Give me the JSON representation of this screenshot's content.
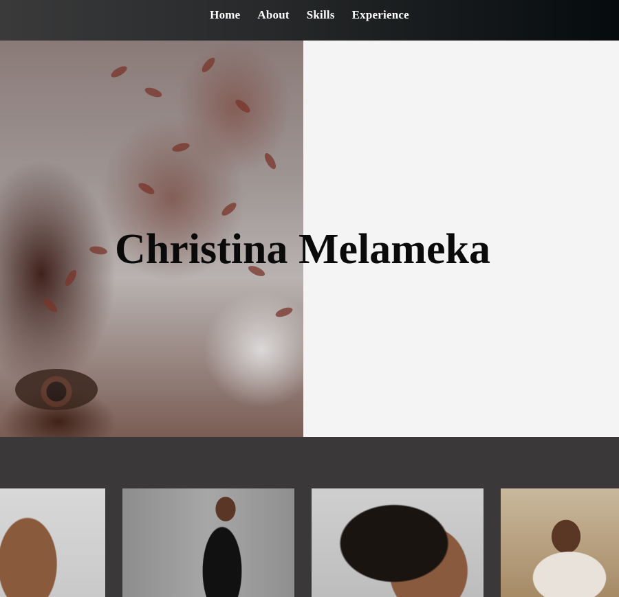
{
  "nav": {
    "items": [
      {
        "label": "Home"
      },
      {
        "label": "About"
      },
      {
        "label": "Skills"
      },
      {
        "label": "Experience"
      }
    ]
  },
  "hero": {
    "title": "Christina Melameka",
    "photo_description_icon": "portrait-photo"
  },
  "gallery": {
    "thumbs": [
      {
        "icon": "portrait-profile-photo"
      },
      {
        "icon": "fashion-pose-photo"
      },
      {
        "icon": "ear-closeup-photo"
      },
      {
        "icon": "lounging-chair-photo"
      }
    ]
  },
  "colors": {
    "nav_bg_start": "#3a3a3b",
    "nav_bg_end": "#060b0d",
    "hero_bg": "#f4f4f4",
    "page_bg": "#3a3839",
    "title_color": "#0a0a0a"
  }
}
